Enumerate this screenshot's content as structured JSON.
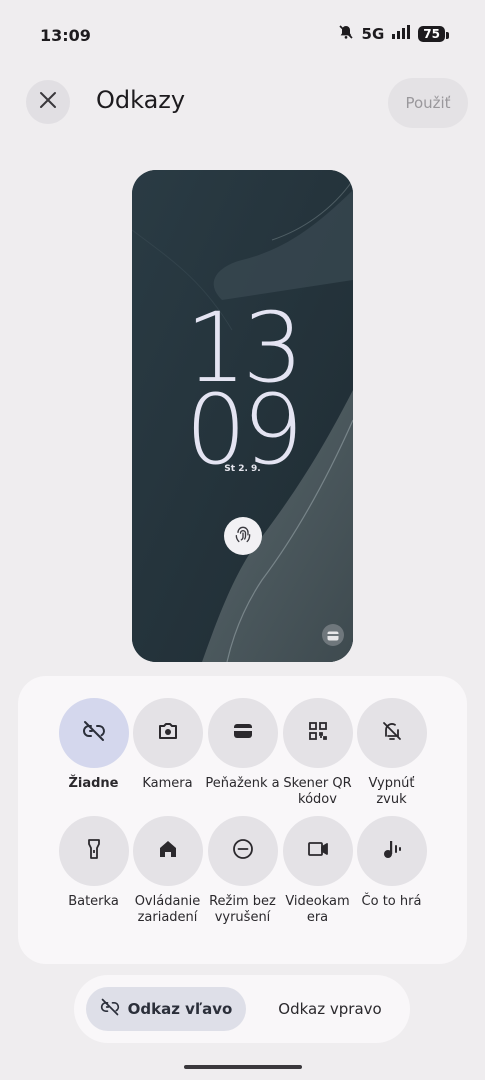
{
  "status_bar": {
    "time": "13:09",
    "network": "5G",
    "battery": "75"
  },
  "header": {
    "title": "Odkazy",
    "apply_label": "Použiť"
  },
  "preview": {
    "hours": "13",
    "minutes": "09",
    "date": "St 2. 9."
  },
  "shortcuts": [
    {
      "label": "Žiadne",
      "icon": "link-off-icon",
      "selected": true
    },
    {
      "label": "Kamera",
      "icon": "camera-icon",
      "selected": false
    },
    {
      "label": "Peňaženk a",
      "icon": "wallet-icon",
      "selected": false
    },
    {
      "label": "Skener QR kódov",
      "icon": "qr-scanner-icon",
      "selected": false
    },
    {
      "label": "Vypnúť zvuk",
      "icon": "bell-off-icon",
      "selected": false
    },
    {
      "label": "Baterka",
      "icon": "flashlight-icon",
      "selected": false
    },
    {
      "label": "Ovládanie zariadení",
      "icon": "home-icon",
      "selected": false
    },
    {
      "label": "Režim bez vyrušení",
      "icon": "do-not-disturb-icon",
      "selected": false
    },
    {
      "label": "Videokam era",
      "icon": "video-camera-icon",
      "selected": false
    },
    {
      "label": "Čo to hrá",
      "icon": "now-playing-icon",
      "selected": false
    }
  ],
  "side_toggle": {
    "left_label": "Odkaz vľavo",
    "right_label": "Odkaz vpravo",
    "selected": "left"
  }
}
